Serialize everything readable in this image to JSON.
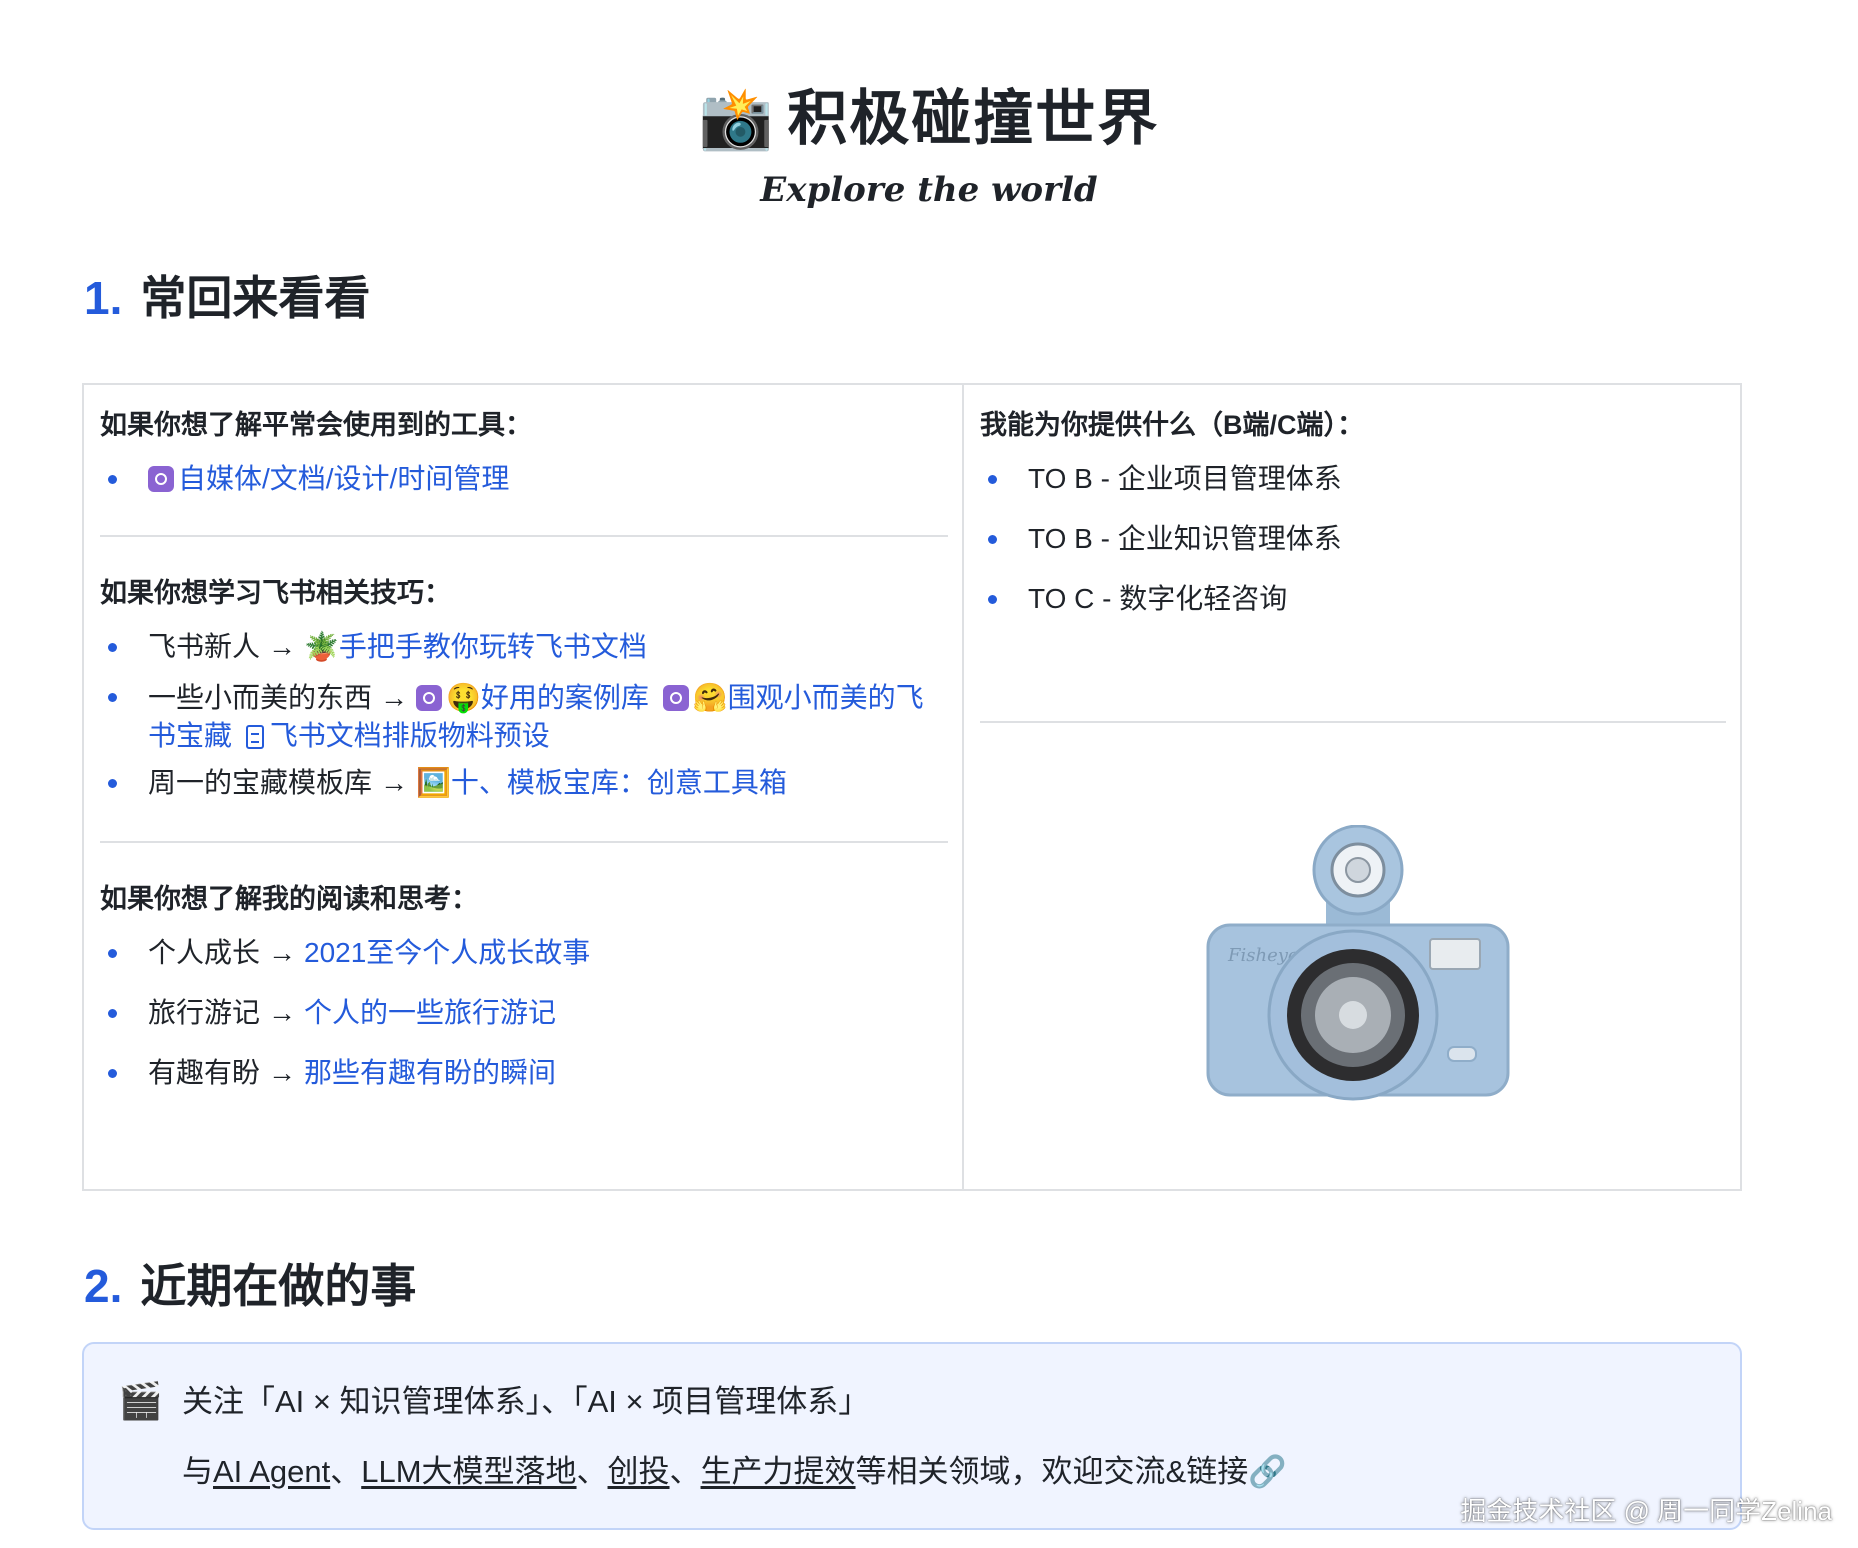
{
  "header": {
    "title_emoji": "📸",
    "title": "积极碰撞世界",
    "subtitle": "Explore the world"
  },
  "section1": {
    "number": "1.",
    "title": "常回来看看"
  },
  "left_cell": {
    "tools": {
      "heading": "如果你想了解平常会使用到的工具：",
      "items": [
        {
          "link": "自媒体/文档/设计/时间管理"
        }
      ]
    },
    "feishu": {
      "heading": "如果你想学习飞书相关技巧：",
      "item1": {
        "prefix": "飞书新人",
        "arrow": "→",
        "emoji": "🪴",
        "link": "手把手教你玩转飞书文档"
      },
      "item2": {
        "prefix": "一些小而美的东西",
        "arrow": "→",
        "emoji1": "🤑",
        "link1": "好用的案例库",
        "emoji2": "🤗",
        "link2": "围观小而美的飞书宝藏",
        "link3": "飞书文档排版物料预设"
      },
      "item3": {
        "prefix": "周一的宝藏模板库",
        "arrow": "→",
        "emoji": "🖼️",
        "link": "十、模板宝库：创意工具箱"
      }
    },
    "reading": {
      "heading": "如果你想了解我的阅读和思考：",
      "items": [
        {
          "prefix": "个人成长",
          "arrow": "→",
          "link": "2021至今个人成长故事"
        },
        {
          "prefix": "旅行游记",
          "arrow": "→",
          "link": "个人的一些旅行游记"
        },
        {
          "prefix": "有趣有盼",
          "arrow": "→",
          "link": "那些有趣有盼的瞬间"
        }
      ]
    }
  },
  "right_cell": {
    "heading": "我能为你提供什么（B端/C端）：",
    "items": [
      "TO B - 企业项目管理体系",
      "TO B - 企业知识管理体系",
      "TO C - 数字化轻咨询"
    ],
    "camera_brand": "Fisheye"
  },
  "section2": {
    "number": "2.",
    "title": "近期在做的事"
  },
  "callout": {
    "icon": "🎬",
    "line1": "关注「AI × 知识管理体系」、「AI × 项目管理体系」",
    "line2_prefix": "与",
    "topic1": "AI Agent",
    "sep1": "、",
    "topic2": "LLM大模型落地",
    "sep2": "、",
    "topic3": "创投",
    "sep3": "、",
    "topic4": "生产力提效",
    "line2_suffix": "等相关领域，欢迎交流&链接🔗"
  },
  "watermark": "掘金技术社区 @ 周一同学Zelina"
}
